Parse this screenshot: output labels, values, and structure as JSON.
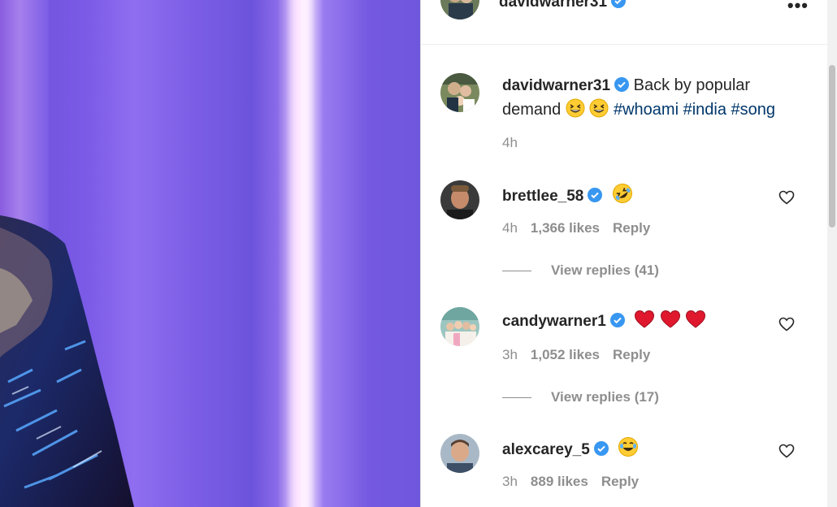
{
  "post": {
    "header_username": "davidwarner31",
    "caption_username": "davidwarner31",
    "caption_text": "Back by popular demand",
    "caption_emojis": [
      "grinning-squinting-face",
      "grinning-squinting-face"
    ],
    "hashtags": [
      "#whoami",
      "#india",
      "#song"
    ],
    "time": "4h"
  },
  "comments": [
    {
      "username": "brettlee_58",
      "emojis": [
        "rolling-on-floor-laughing"
      ],
      "time": "4h",
      "likes": "1,366 likes",
      "reply_label": "Reply",
      "view_replies": "View replies (41)"
    },
    {
      "username": "candywarner1",
      "emojis": [
        "red-heart",
        "red-heart",
        "red-heart"
      ],
      "time": "3h",
      "likes": "1,052 likes",
      "reply_label": "Reply",
      "view_replies": "View replies (17)"
    },
    {
      "username": "alexcarey_5",
      "emojis": [
        "face-with-tears-of-joy"
      ],
      "time": "3h",
      "likes": "889 likes",
      "reply_label": "Reply"
    }
  ],
  "icons": {
    "more": "more-options-icon",
    "verified": "verified-badge-icon",
    "like": "heart-outline-icon"
  },
  "colors": {
    "verified": "#3897f0",
    "link": "#00376b",
    "muted": "#8e8e8e",
    "text": "#262626"
  }
}
